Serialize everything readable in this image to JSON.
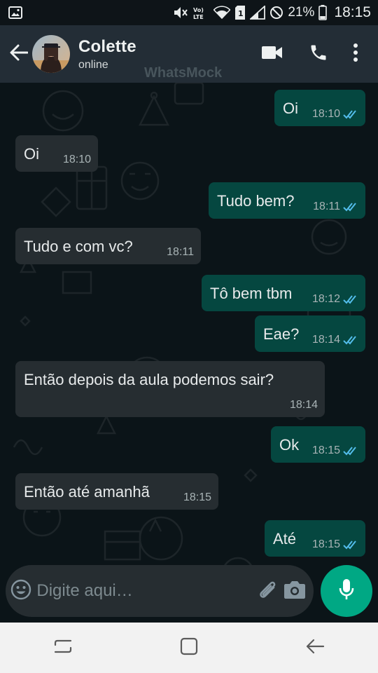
{
  "status_bar": {
    "battery": "21%",
    "time": "18:15",
    "sim_slot": "1",
    "volte": "Vo) LTE"
  },
  "header": {
    "contact_name": "Colette",
    "contact_status": "online",
    "watermark": "WhatsMock"
  },
  "messages": [
    {
      "direction": "out",
      "text": "Oi",
      "time": "18:10",
      "read": true
    },
    {
      "direction": "in",
      "text": "Oi",
      "time": "18:10"
    },
    {
      "direction": "out",
      "text": "Tudo bem?",
      "time": "18:11",
      "read": true
    },
    {
      "direction": "in",
      "text": "Tudo e com vc?",
      "time": "18:11"
    },
    {
      "direction": "out",
      "text": "Tô bem tbm",
      "time": "18:12",
      "read": true
    },
    {
      "direction": "out",
      "text": "Eae?",
      "time": "18:14",
      "read": true
    },
    {
      "direction": "in",
      "text": "Então depois da aula podemos sair?",
      "time": "18:14"
    },
    {
      "direction": "out",
      "text": "Ok",
      "time": "18:15",
      "read": true
    },
    {
      "direction": "in",
      "text": "Então até amanhã",
      "time": "18:15"
    },
    {
      "direction": "out",
      "text": "Até",
      "time": "18:15",
      "read": true
    }
  ],
  "composer": {
    "placeholder": "Digite aqui…"
  },
  "colors": {
    "header_bg": "#232d36",
    "incoming_bubble": "#262d31",
    "outgoing_bubble": "#054740",
    "accent": "#00a884",
    "read_ticks": "#53bdeb"
  },
  "icons": {
    "status_bar": [
      "gallery-icon",
      "mute-icon",
      "volte-icon",
      "wifi-icon",
      "sim-icon",
      "signal-icon",
      "dnd-icon",
      "battery-icon"
    ],
    "header": [
      "back-arrow-icon",
      "video-call-icon",
      "voice-call-icon",
      "more-menu-icon"
    ],
    "composer": [
      "emoji-icon",
      "attach-icon",
      "camera-icon",
      "mic-icon"
    ],
    "nav": [
      "recents-icon",
      "home-icon",
      "back-icon"
    ]
  }
}
